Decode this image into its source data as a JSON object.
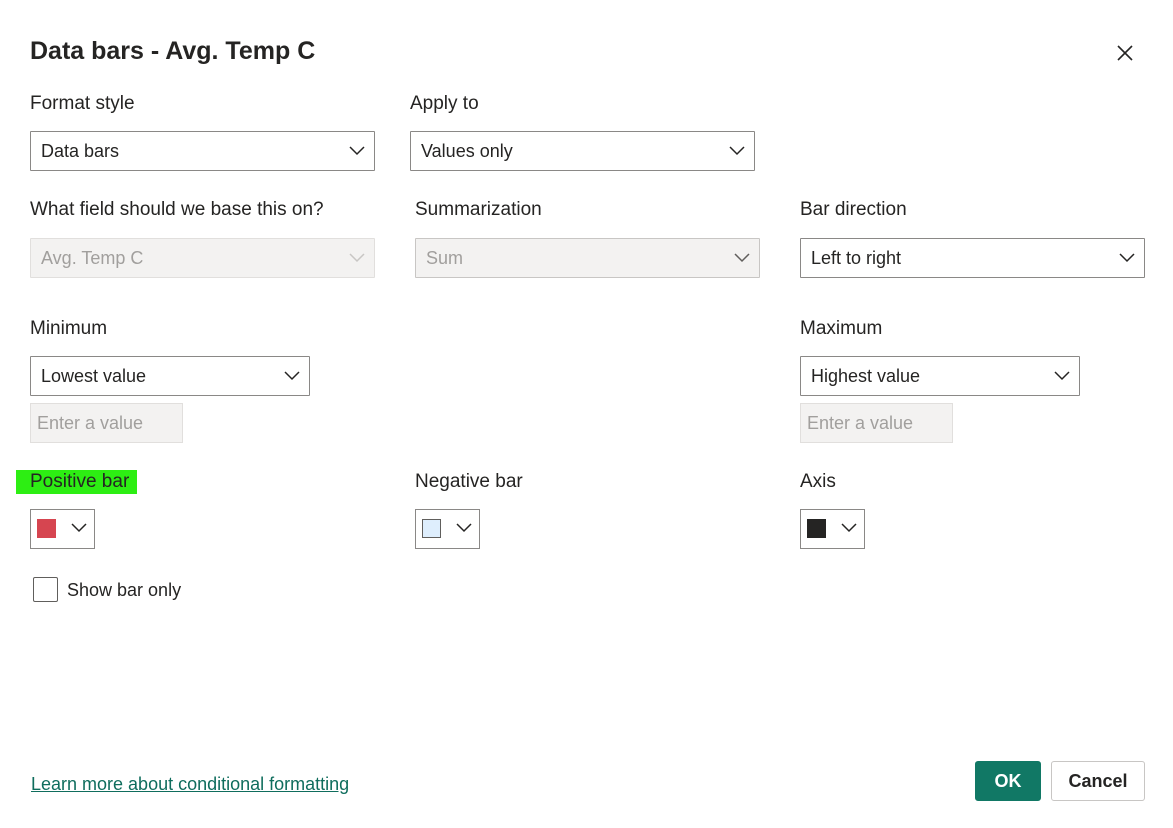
{
  "dialog": {
    "title": "Data bars - Avg. Temp C",
    "close_icon": "close-icon"
  },
  "format_style": {
    "label": "Format style",
    "value": "Data bars"
  },
  "apply_to": {
    "label": "Apply to",
    "value": "Values only"
  },
  "base_field": {
    "label": "What field should we base this on?",
    "value": "Avg. Temp C"
  },
  "summarization": {
    "label": "Summarization",
    "value": "Sum"
  },
  "bar_direction": {
    "label": "Bar direction",
    "value": "Left to right"
  },
  "minimum": {
    "label": "Minimum",
    "value": "Lowest value",
    "placeholder": "Enter a value"
  },
  "maximum": {
    "label": "Maximum",
    "value": "Highest value",
    "placeholder": "Enter a value"
  },
  "positive_bar": {
    "label": "Positive bar",
    "color": "#d64550"
  },
  "negative_bar": {
    "label": "Negative bar",
    "color": "#deeefd"
  },
  "axis": {
    "label": "Axis",
    "color": "#252423"
  },
  "show_bar_only": {
    "label": "Show bar only",
    "checked": false
  },
  "footer": {
    "learn_more": "Learn more about conditional formatting",
    "ok": "OK",
    "cancel": "Cancel"
  },
  "colors": {
    "accent": "#117865",
    "highlight": "#2dee13",
    "disabled_bg": "#f3f2f1"
  }
}
